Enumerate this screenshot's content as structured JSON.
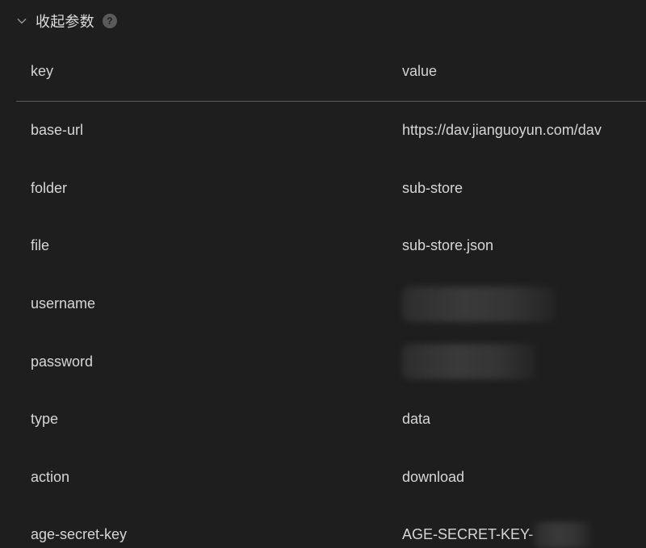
{
  "section": {
    "title": "收起参数",
    "help_glyph": "?",
    "chevron_icon": "chevron-down-icon"
  },
  "table": {
    "headers": {
      "key": "key",
      "value": "value"
    },
    "rows": [
      {
        "key": "base-url",
        "value": "https://dav.jianguoyun.com/dav"
      },
      {
        "key": "folder",
        "value": "sub-store"
      },
      {
        "key": "file",
        "value": "sub-store.json"
      },
      {
        "key": "username",
        "value": null
      },
      {
        "key": "password",
        "value": null
      },
      {
        "key": "type",
        "value": "data"
      },
      {
        "key": "action",
        "value": "download"
      },
      {
        "key": "age-secret-key",
        "value": "AGE-SECRET-KEY-"
      }
    ]
  },
  "colors": {
    "background": "#1e1e1e",
    "text": "#d6d6d6",
    "divider": "#5c5c5c"
  }
}
